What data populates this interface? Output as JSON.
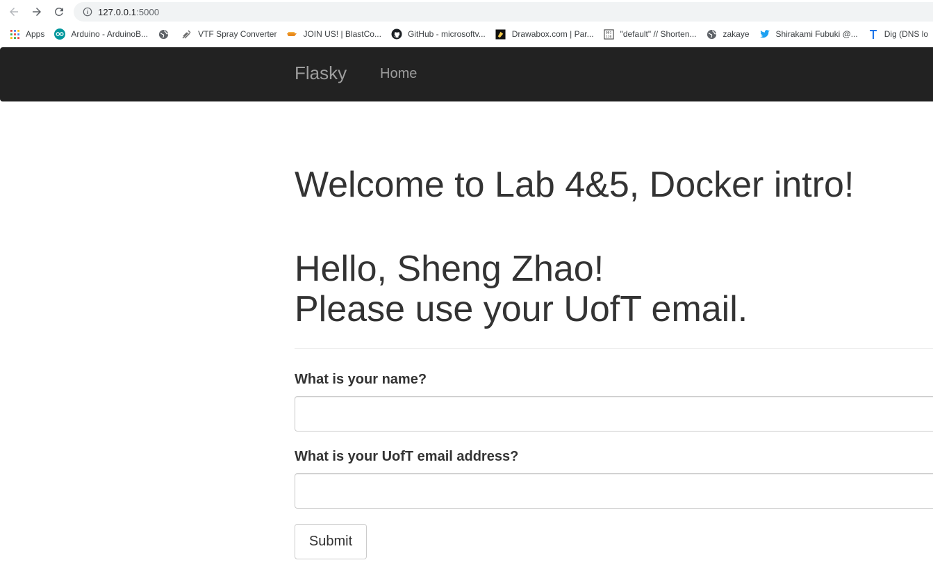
{
  "browser": {
    "url_host": "127.0.0.1",
    "url_port": ":5000",
    "bookmarks": [
      {
        "label": "Apps",
        "icon": "apps-grid-icon"
      },
      {
        "label": "Arduino - ArduinoB...",
        "icon": "arduino-icon"
      },
      {
        "label": "",
        "icon": "globe-icon"
      },
      {
        "label": "VTF Spray Converter",
        "icon": "spray-icon"
      },
      {
        "label": "JOIN US! | BlastCo...",
        "icon": "blast-icon"
      },
      {
        "label": "GitHub - microsoftv...",
        "icon": "github-icon"
      },
      {
        "label": "Drawabox.com | Par...",
        "icon": "drawabox-icon"
      },
      {
        "label": "\"default\" // Shorten...",
        "icon": "shorten-icon"
      },
      {
        "label": "zakaye",
        "icon": "globe-icon"
      },
      {
        "label": "Shirakami Fubuki @...",
        "icon": "twitter-icon"
      },
      {
        "label": "Dig (DNS lo",
        "icon": "dig-icon"
      }
    ]
  },
  "navbar": {
    "brand": "Flasky",
    "home": "Home"
  },
  "main": {
    "welcome": "Welcome to Lab 4&5, Docker intro!",
    "hello": "Hello, Sheng Zhao!",
    "notice": "Please use your UofT email."
  },
  "form": {
    "name_label": "What is your name?",
    "name_value": "",
    "email_label": "What is your UofT email address?",
    "email_value": "",
    "submit_label": "Submit"
  },
  "colors": {
    "navbar_bg": "#222222",
    "navbar_text": "#9d9d9d",
    "body_text": "#333333"
  }
}
